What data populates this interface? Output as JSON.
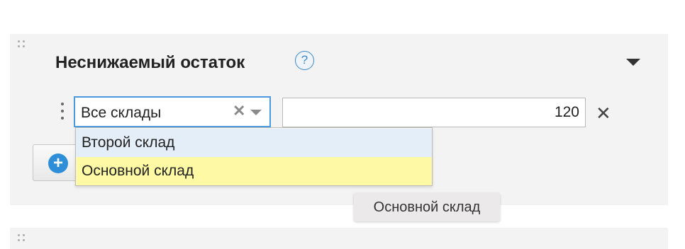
{
  "section": {
    "title": "Неснижаемый остаток",
    "help_symbol": "?"
  },
  "row": {
    "warehouse_select": {
      "value": "Все склады",
      "clear_symbol": "✕"
    },
    "quantity": "120",
    "remove_symbol": "✕"
  },
  "dropdown": {
    "options": [
      {
        "label": "Второй склад",
        "state": "hover"
      },
      {
        "label": "Основной склад",
        "state": "highlighted"
      }
    ]
  },
  "add_button": {
    "icon": "plus-circle-icon",
    "symbol": "+"
  },
  "tooltip": {
    "text": "Основной склад"
  },
  "colors": {
    "accent": "#4b9ae0",
    "help_blue": "#3a87c8",
    "hover_bg": "#e4eef8",
    "highlight_bg": "#fef9a4",
    "panel_bg": "#f3f3f3"
  }
}
